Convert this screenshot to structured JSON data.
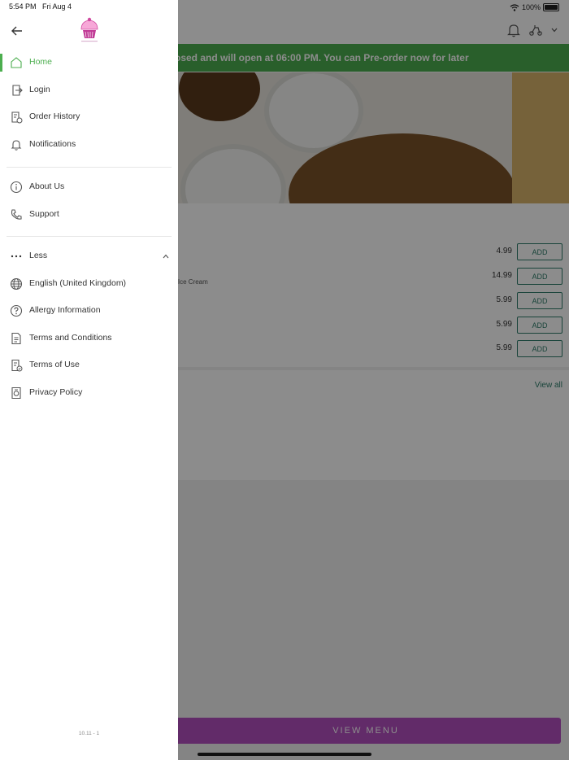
{
  "status": {
    "time": "5:54 PM",
    "date": "Fri Aug 4",
    "battery": "100%"
  },
  "banner": {
    "text": "osed and will open at 06:00 PM. You can Pre-order now for later"
  },
  "menu": {
    "items": [
      {
        "price": "4.99",
        "add_label": "ADD"
      },
      {
        "price": "14.99",
        "add_label": "ADD"
      },
      {
        "price": "5.99",
        "add_label": "ADD"
      },
      {
        "price": "5.99",
        "add_label": "ADD"
      },
      {
        "price": "5.99",
        "add_label": "ADD"
      }
    ],
    "item2_desc": "of Ice Cream",
    "view_all": "View all",
    "view_menu": "VIEW MENU"
  },
  "drawer": {
    "items": [
      {
        "label": "Home",
        "icon": "home-icon",
        "active": true
      },
      {
        "label": "Login",
        "icon": "login-icon"
      },
      {
        "label": "Order History",
        "icon": "order-history-icon"
      },
      {
        "label": "Notifications",
        "icon": "bell-icon"
      },
      {
        "label": "About Us",
        "icon": "info-icon"
      },
      {
        "label": "Support",
        "icon": "phone-icon"
      },
      {
        "label": "Less",
        "icon": "more-dots-icon"
      },
      {
        "label": "English (United Kingdom)",
        "icon": "globe-icon"
      },
      {
        "label": "Allergy Information",
        "icon": "question-icon"
      },
      {
        "label": "Terms and Conditions",
        "icon": "document-icon"
      },
      {
        "label": "Terms of Use",
        "icon": "terms-of-use-icon"
      },
      {
        "label": "Privacy Policy",
        "icon": "privacy-icon"
      }
    ],
    "version": "10.11 - 1"
  },
  "colors": {
    "accent_green": "#4cae4f",
    "menu_purple": "#b34fc0",
    "add_outline": "#2e7d6b"
  }
}
